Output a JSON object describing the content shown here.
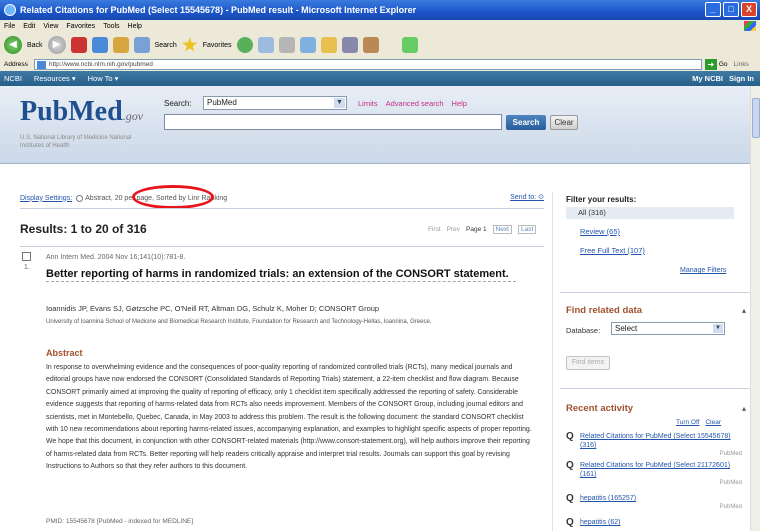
{
  "window": {
    "title": "Related Citations for PubMed (Select 15545678) - PubMed result - Microsoft Internet Explorer",
    "buttons": [
      "_",
      "□",
      "X"
    ]
  },
  "menubar": [
    "File",
    "Edit",
    "View",
    "Favorites",
    "Tools",
    "Help"
  ],
  "toolbar": {
    "back": "Back",
    "search": "Search",
    "favorites": "Favorites"
  },
  "address": {
    "label": "Address",
    "url": "http://www.ncbi.nlm.nih.gov/pubmed",
    "go": "Go",
    "links": "Links"
  },
  "ncbi": {
    "brand": "NCBI",
    "resources": "Resources",
    "howto": "How To",
    "mync": "My NCBI",
    "signin": "Sign In"
  },
  "header": {
    "logo_pub": "Pub",
    "logo_med": "Med",
    "logo_gov": ".gov",
    "logo_sub": "U.S. National Library of Medicine National Institutes of Health",
    "search_label": "Search:",
    "db_value": "PubMed",
    "links": [
      "Limits",
      "Advanced search",
      "Help"
    ],
    "search_button": "Search",
    "clear_button": "Clear"
  },
  "display": {
    "settings": "Display Settings:",
    "format": "Abstract, 20 per page, Sorted by Linr Ranking",
    "sendto": "Send to:"
  },
  "results": {
    "count": "Results: 1 to 20 of 316",
    "first": "First",
    "prev": "Prev",
    "page": "Page 1",
    "next": "Next",
    "last": "Last"
  },
  "item": {
    "number": "1.",
    "source": "Ann Intern Med. 2004 Nov 16;141(10):781-8.",
    "title": "Better reporting of harms in randomized trials: an extension of the CONSORT statement.",
    "authors": "Ioannidis JP, Evans SJ, Gøtzsche PC, O'Neill RT, Altman DG, Schulz K, Moher D; CONSORT Group",
    "affiliation": "University of Ioannina School of Medicine and Biomedical Research Institute, Foundation for Research and Technology-Hellas, Ioannina, Greece.",
    "abstract_heading": "Abstract",
    "abstract": "In response to overwhelming evidence and the consequences of poor-quality reporting of randomized controlled trials (RCTs), many medical journals and editorial groups have now endorsed the CONSORT (Consolidated Standards of Reporting Trials) statement, a 22-item checklist and flow diagram. Because CONSORT primarily aimed at improving the quality of reporting of efficacy, only 1 checklist item specifically addressed the reporting of safety. Considerable evidence suggests that reporting of harms-related data from RCTs also needs improvement. Members of the CONSORT Group, including journal editors and scientists, met in Montebello, Quebec, Canada, in May 2003 to address this problem. The result is the following document: the standard CONSORT checklist with 10 new recommendations about reporting harms-related issues, accompanying explanation, and examples to highlight specific aspects of proper reporting. We hope that this document, in conjunction with other CONSORT-related materials (http://www.consort-statement.org), will help authors improve their reporting of harms-related data from RCTs. Better reporting will help readers critically appraise and interpret trial results. Journals can support this goal by revising Instructions to Authors so that they refer authors to this document.",
    "pmid": "PMID: 15545678 [PubMed - indexed for MEDLINE]"
  },
  "sidebar": {
    "filter_heading": "Filter your results:",
    "filter_all": "All (316)",
    "filters": [
      "Review (65)",
      "Free Full Text (107)"
    ],
    "manage": "Manage Filters",
    "find_heading": "Find related data",
    "database_label": "Database:",
    "database_value": "Select",
    "find_button": "Find items",
    "recent_heading": "Recent activity",
    "turn_off": "Turn Off",
    "clear": "Clear",
    "recent": [
      {
        "text": "Related Citations for PubMed (Select 15545678) (316)",
        "db": "PubMed"
      },
      {
        "text": "Related Citations for PubMed (Select 21172601) (161)",
        "db": "PubMed"
      },
      {
        "text": "hepatitis (165257)",
        "db": "PubMed"
      },
      {
        "text": "hepatitis (62)",
        "db": ""
      }
    ]
  }
}
